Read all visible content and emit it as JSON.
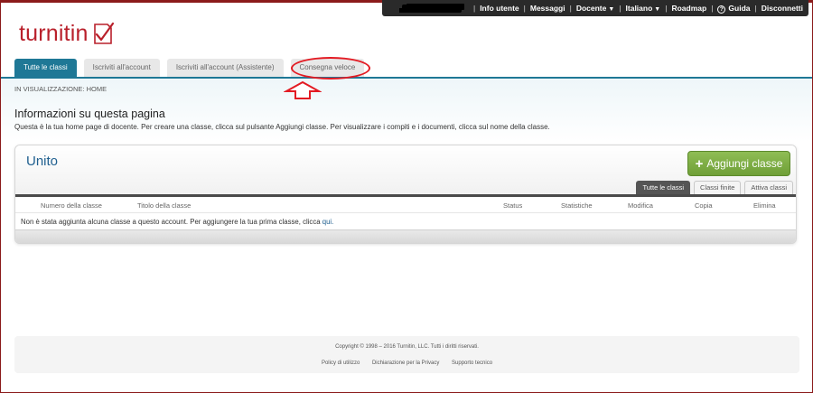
{
  "topbar": {
    "items": [
      {
        "label": "Info utente"
      },
      {
        "label": "Messaggi"
      },
      {
        "label": "Docente",
        "caret": "▼"
      },
      {
        "label": "Italiano",
        "caret": "▼"
      },
      {
        "label": "Roadmap"
      },
      {
        "label": "Guida",
        "icon": "help-circle-icon"
      },
      {
        "label": "Disconnetti"
      }
    ]
  },
  "logo": {
    "text": "turnitin"
  },
  "tabs": [
    {
      "label": "Tutte le classi",
      "active": true
    },
    {
      "label": "Iscriviti all'account",
      "active": false
    },
    {
      "label": "Iscriviti all'account (Assistente)",
      "active": false
    },
    {
      "label": "Consegna veloce",
      "active": false
    }
  ],
  "breadcrumb": "IN VISUALIZZAZIONE: HOME",
  "info": {
    "title": "Informazioni su questa pagina",
    "text": "Questa è la tua home page di docente. Per creare una classe, clicca sul pulsante Aggiungi classe. Per visualizzare i compiti e i documenti, clicca sul nome della classe."
  },
  "panel": {
    "title": "Unito",
    "add_button": "Aggiungi classe",
    "subtabs": [
      {
        "label": "Tutte le classi",
        "active": true
      },
      {
        "label": "Classi finite",
        "active": false
      },
      {
        "label": "Attiva classi",
        "active": false
      }
    ],
    "columns": [
      "Numero della classe",
      "Titolo della classe",
      "Status",
      "Statistiche",
      "Modifica",
      "Copia",
      "Elimina"
    ],
    "empty_message": "Non è stata aggiunta alcuna classe a questo account. Per aggiungere la tua prima classe, clicca",
    "empty_link": "qui."
  },
  "footer": {
    "copyright": "Copyright © 1998 – 2016 Turnitin, LLC. Tutti i diritti riservati.",
    "links": [
      "Policy di utilizzo",
      "Dichiarazione per la Privacy",
      "Supporto tecnico"
    ]
  },
  "colors": {
    "brand": "#b9202b",
    "tab_active": "#1f7896",
    "add_button": "#7aab41",
    "highlight": "#e31b23"
  }
}
